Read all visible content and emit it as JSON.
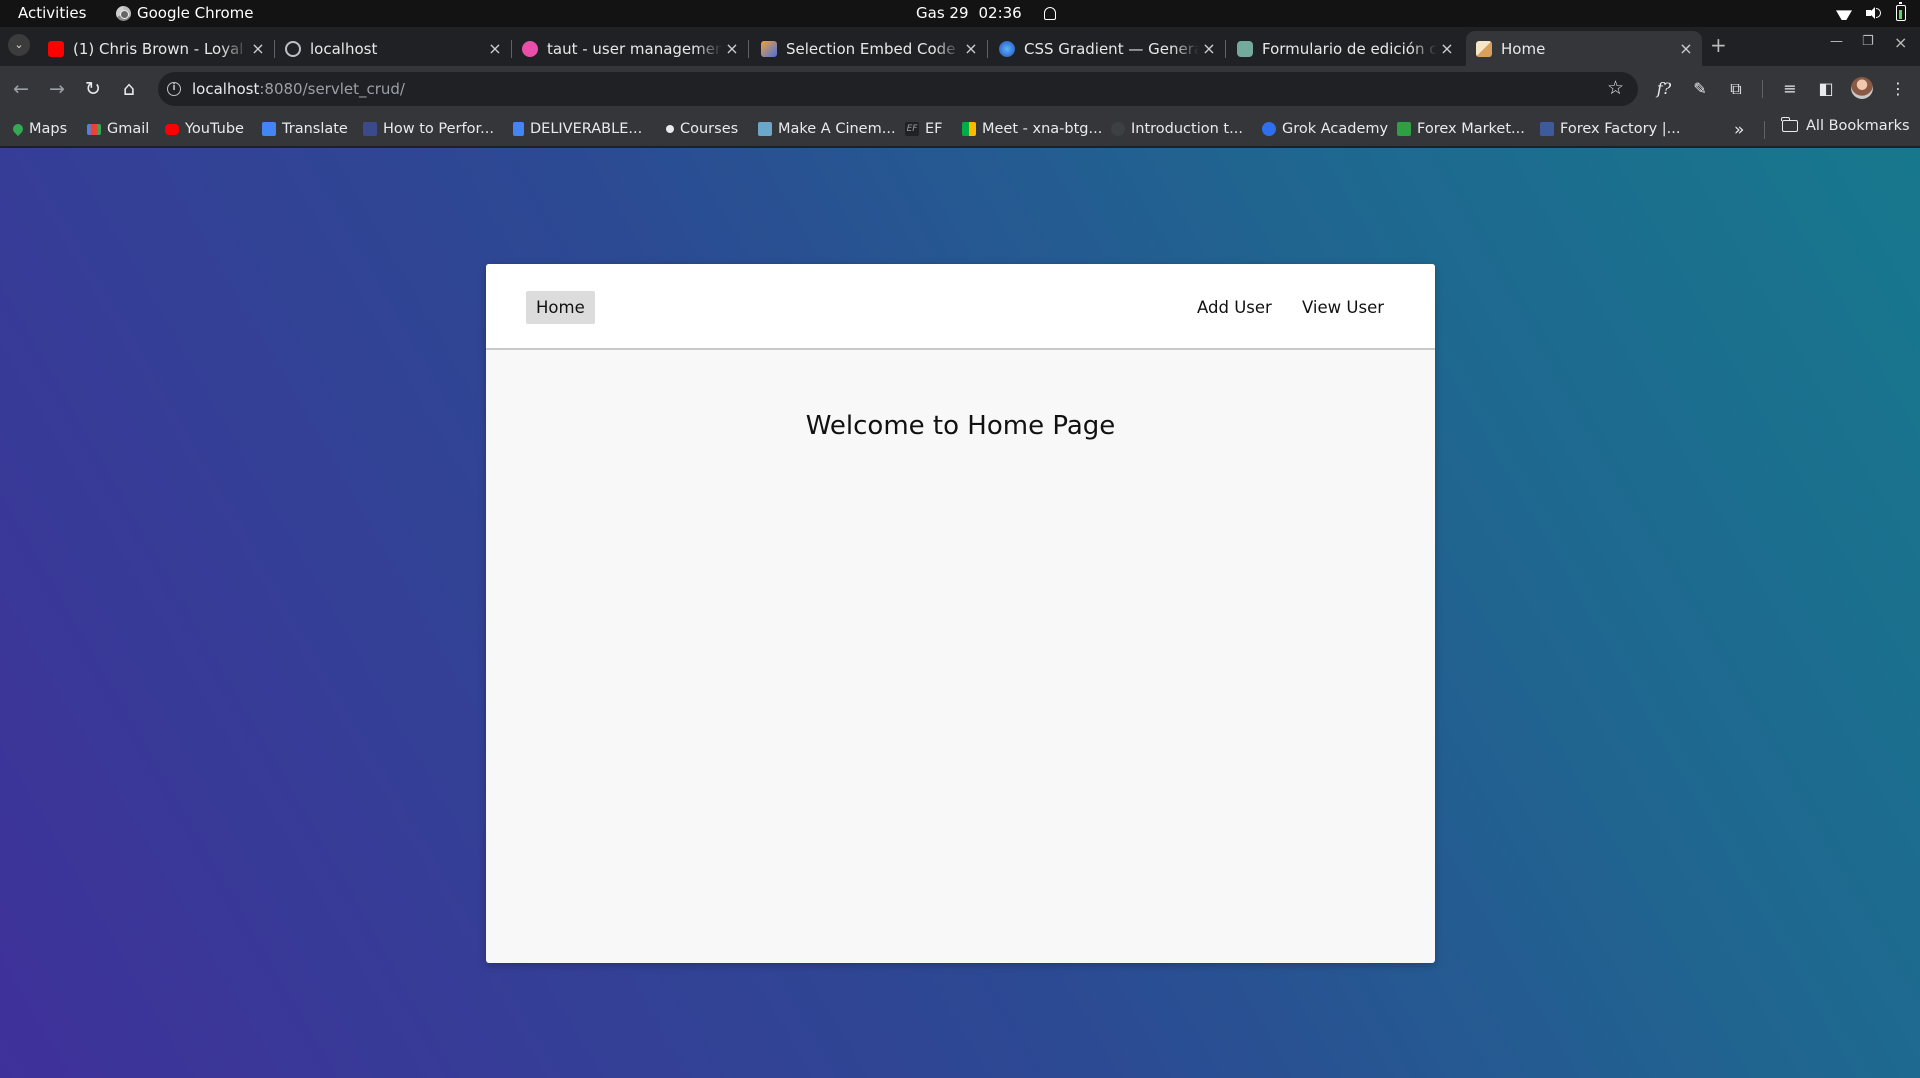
{
  "system_bar": {
    "activities": "Activities",
    "app_name": "Google Chrome",
    "date": "Gas 29",
    "time": "02:36"
  },
  "tabs": [
    {
      "title": "(1) Chris Brown - Loyal (",
      "favicon_color": "#ff0000",
      "active": false
    },
    {
      "title": "localhost",
      "favicon_color": "#bdc1c6",
      "active": false
    },
    {
      "title": "taut - user management",
      "favicon_color": "#e94fa8",
      "active": false
    },
    {
      "title": "Selection Embed Code - (",
      "favicon_color": "#f0a23a",
      "active": false
    },
    {
      "title": "CSS Gradient — Generat",
      "favicon_color": "#2a7de1",
      "active": false
    },
    {
      "title": "Formulario de edición co",
      "favicon_color": "#74aa9c",
      "active": false
    },
    {
      "title": "Home",
      "favicon_color": "#d9a05b",
      "active": true
    }
  ],
  "new_tab_label": "+",
  "address_bar": {
    "host": "localhost",
    "path": ":8080/servlet_crud/"
  },
  "bookmarks": [
    {
      "label": "Maps",
      "icon_color": "#34a853"
    },
    {
      "label": "Gmail",
      "icon_color": "#ea4335"
    },
    {
      "label": "YouTube",
      "icon_color": "#ff0000"
    },
    {
      "label": "Translate",
      "icon_color": "#4285f4"
    },
    {
      "label": "How to Perfor...",
      "icon_color": "#3b4a8a"
    },
    {
      "label": "DELIVERABLE...",
      "icon_color": "#4285f4"
    },
    {
      "label": "Courses",
      "icon_color": "#e8eaed"
    },
    {
      "label": "Make A Cinem...",
      "icon_color": "#6aa7c9"
    },
    {
      "label": "EF",
      "icon_color": "#202124"
    },
    {
      "label": "Meet - xna-btg...",
      "icon_color": "#00ac47"
    },
    {
      "label": "Introduction t...",
      "icon_color": "#3c4043"
    },
    {
      "label": "Grok Academy",
      "icon_color": "#2f6fed"
    },
    {
      "label": "Forex Market...",
      "icon_color": "#2ea043"
    },
    {
      "label": "Forex Factory |...",
      "icon_color": "#3d5a9c"
    }
  ],
  "bookmarks_more": "»",
  "all_bookmarks": "All Bookmarks",
  "page": {
    "nav": {
      "home": "Home",
      "add_user": "Add User",
      "view_user": "View User"
    },
    "heading": "Welcome to Home Page",
    "gradient_colors": [
      "#3f319a",
      "#17788d"
    ]
  }
}
